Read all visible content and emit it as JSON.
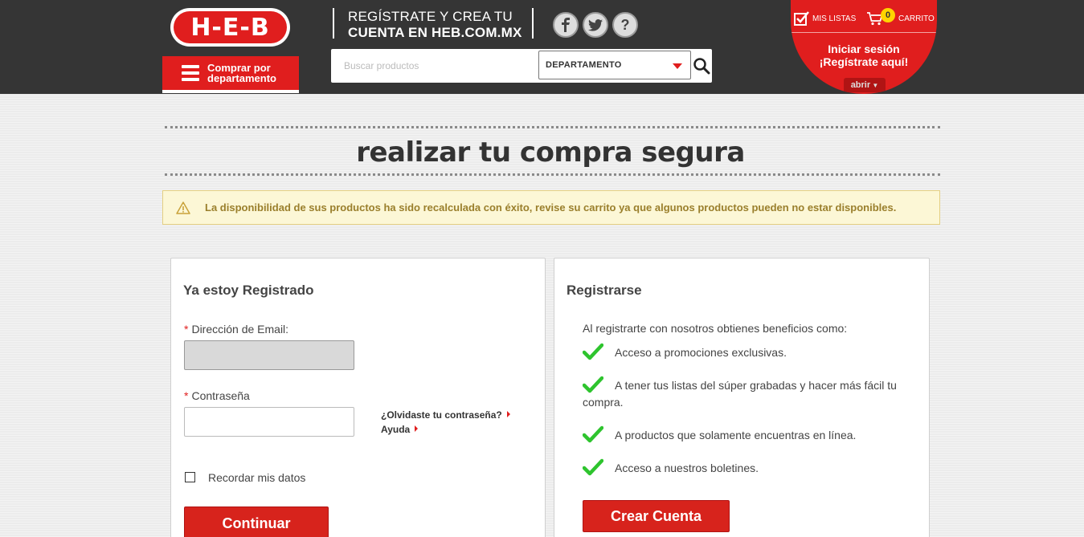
{
  "header": {
    "logo_text": "H-E-B",
    "dept_button_label": "Comprar por departamento",
    "register_line1": "REGÍSTRATE Y CREA TU",
    "register_line2": "CUENTA EN HEB.COM.MX",
    "social": [
      "facebook-icon",
      "twitter-icon",
      "help-icon"
    ],
    "help_glyph": "?",
    "search_placeholder": "Buscar productos",
    "dept_select_value": "DEPARTAMENTO",
    "mis_listas": "MIS LISTAS",
    "carrito": "CARRITO",
    "cart_count": "0",
    "login_line1": "Iniciar sesión",
    "login_line2": "¡Regístrate aquí!",
    "abrir": "abrir"
  },
  "page": {
    "title": "realizar tu compra segura",
    "alert": "La disponibilidad de sus productos ha sido recalculada con éxito, revise su carrito ya que algunos productos pueden no estar disponibles."
  },
  "login": {
    "title": "Ya estoy Registrado",
    "required_mark": "*",
    "email_label": "Dirección de Email:",
    "email_value": "",
    "password_label": "Contraseña",
    "password_value": "",
    "forgot_link": "¿Olvidaste tu contraseña?",
    "help_link": "Ayuda",
    "remember_label": "Recordar mis datos",
    "remember_checked": false,
    "submit_label": "Continuar"
  },
  "register": {
    "title": "Registrarse",
    "intro": "Al registrarte con nosotros obtienes beneficios como:",
    "benefits": [
      "Acceso a promociones exclusivas.",
      "A tener tus listas del súper grabadas y hacer más fácil tu compra.",
      "A productos que solamente encuentras en línea.",
      "Acceso a nuestros boletines."
    ],
    "create_label": "Crear Cuenta"
  },
  "colors": {
    "brand_red": "#e01e1e",
    "header_bg": "#353535",
    "check_green": "#2ec42e",
    "alert_bg": "#fcf7d6"
  }
}
